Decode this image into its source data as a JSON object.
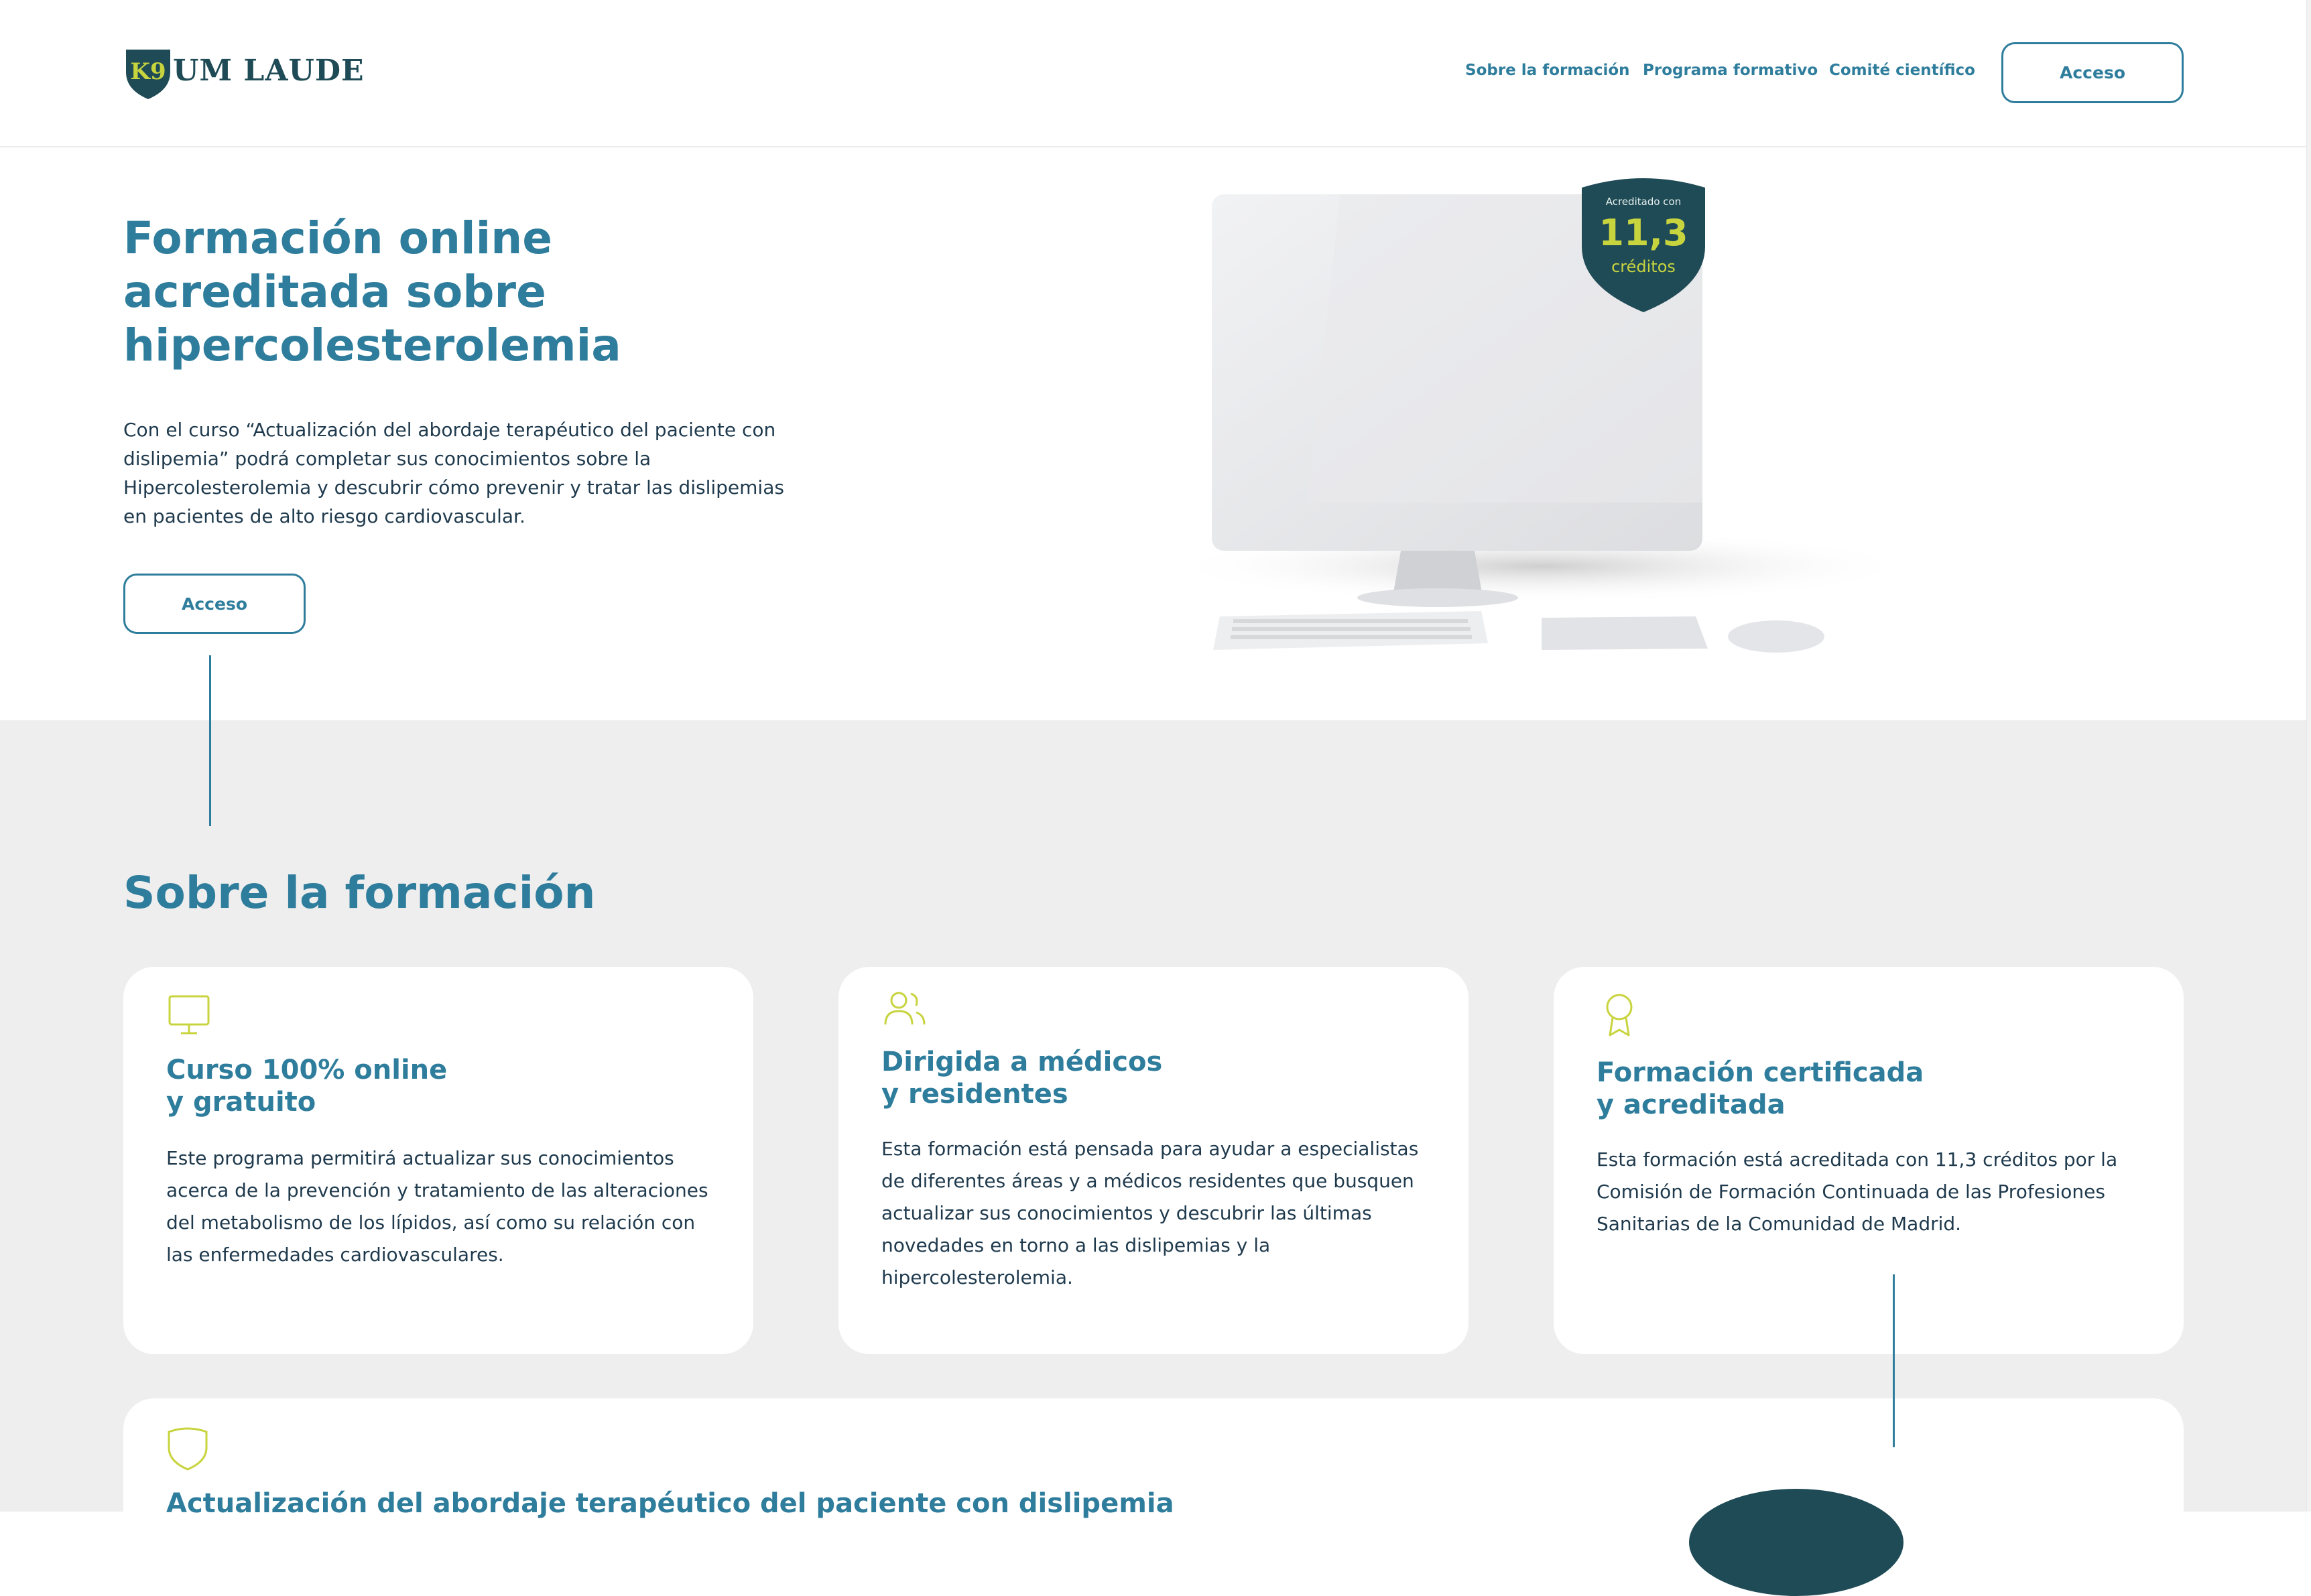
{
  "header": {
    "logo_text": "UM LAUDE",
    "logo_mark": "K9",
    "nav": [
      "Sobre la formación",
      "Programa formativo",
      "Comité científico"
    ],
    "access_label": "Acceso"
  },
  "hero": {
    "title_lines": [
      "Formación online",
      "acreditada sobre",
      "hipercolesterolemia"
    ],
    "description": "Con el curso “Actualización del abordaje terapéutico del paciente con dislipemia” podrá completar sus conocimientos sobre la Hipercolesterolemia y descubrir cómo prevenir y tratar las dislipemias en pacientes de alto riesgo cardiovascular.",
    "access_label": "Acceso",
    "badge": {
      "small": "Acreditado con",
      "number": "11,3",
      "unit": "créditos"
    }
  },
  "about": {
    "title": "Sobre la formación",
    "cards": [
      {
        "icon": "monitor-icon",
        "title_lines": [
          "Curso 100% online",
          "y gratuito"
        ],
        "text": "Este programa permitirá actualizar sus conocimientos acerca de la prevención y tratamiento de las alteraciones del metabolismo de los lípidos, así como su relación con las enfermedades cardiovasculares."
      },
      {
        "icon": "users-icon",
        "title_lines": [
          "Dirigida a médicos",
          "y residentes"
        ],
        "text": "Esta formación está pensada para ayudar a especialistas de diferentes áreas y a médicos residentes que busquen actualizar sus conocimientos y descubrir las últimas novedades en torno a las dislipemias y la hipercolesterolemia."
      },
      {
        "icon": "award-icon",
        "title_lines": [
          "Formación certificada",
          "y acreditada"
        ],
        "text": "Esta formación está acreditada con 11,3 créditos por la Comisión de Formación Continuada de las Profesiones Sanitarias de la Comunidad de Madrid."
      }
    ],
    "wide_card": {
      "icon": "shield-icon",
      "title": "Actualización del abordaje terapéutico del paciente con dislipemia"
    }
  },
  "colors": {
    "primary": "#2f7d9c",
    "accent": "#c8d43e",
    "dark": "#1f4b56",
    "section_bg": "#eeeeee"
  }
}
